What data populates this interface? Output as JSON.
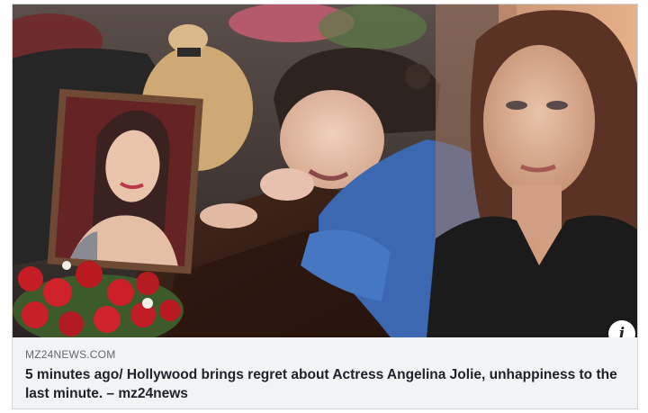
{
  "link_preview": {
    "image_alt": "",
    "domain": "MZ24NEWS.COM",
    "headline": "5 minutes ago/ Hollywood brings regret about Actress Angelina Jolie, unhappiness to the last minute. – mz24news",
    "info_icon": "info-icon",
    "info_glyph": "i"
  },
  "colors": {
    "card_bg": "#f2f3f5",
    "domain_text": "#606770",
    "headline_text": "#1d2129",
    "border": "#d0d3d8"
  }
}
